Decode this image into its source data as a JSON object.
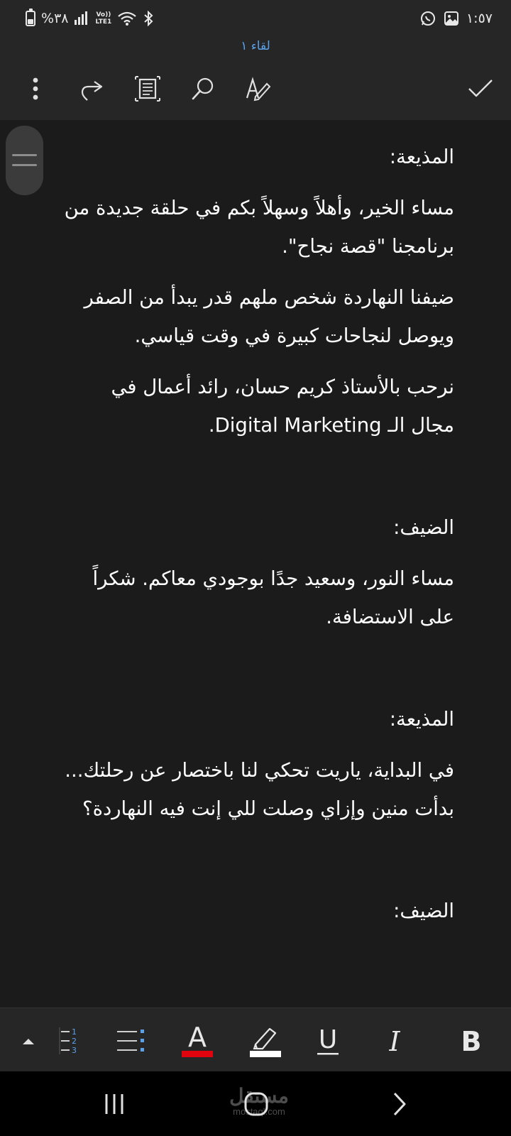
{
  "status_bar": {
    "time": "١:٥٧",
    "battery": "%٣٨",
    "volte": "Vo))",
    "lte": "LTE1"
  },
  "document_title": "لقاء ١",
  "toolbar": {
    "icons": [
      "more-vert-icon",
      "redo-icon",
      "page-view-icon",
      "search-icon",
      "pen-edit-icon",
      "checkmark-icon"
    ]
  },
  "content": {
    "paragraphs": [
      "المذيعة:",
      "مساء الخير، وأهلاً وسهلاً بكم في حلقة جديدة من برنامجنا \"قصة نجاح\".",
      "ضيفنا النهاردة شخص ملهم قدر يبدأ من الصفر ويوصل لنجاحات كبيرة في وقت قياسي.",
      "نرحب بالأستاذ كريم حسان، رائد أعمال في مجال الـ Digital Marketing.",
      "الضيف:",
      "مساء النور، وسعيد جدًا بوجودي معاكم. شكراً على الاستضافة.",
      "المذيعة:",
      "في البداية، ياريت تحكي لنا باختصار عن رحلتك... بدأت منين وإزاي وصلت للي إنت فيه النهاردة؟",
      "الضيف:"
    ]
  },
  "format_bar": {
    "bold": "B",
    "italic": "I",
    "underline": "U",
    "font_color": "A",
    "font_color_swatch": "#e0040f",
    "highlight_swatch": "#ffffff",
    "list_numbers": [
      "1",
      "2",
      "3"
    ]
  },
  "watermark": {
    "arabic": "مستقل",
    "latin": "mostaql.com"
  },
  "colors": {
    "accent": "#5ba0ea",
    "background": "#1b1b1b",
    "bar": "#262626"
  }
}
